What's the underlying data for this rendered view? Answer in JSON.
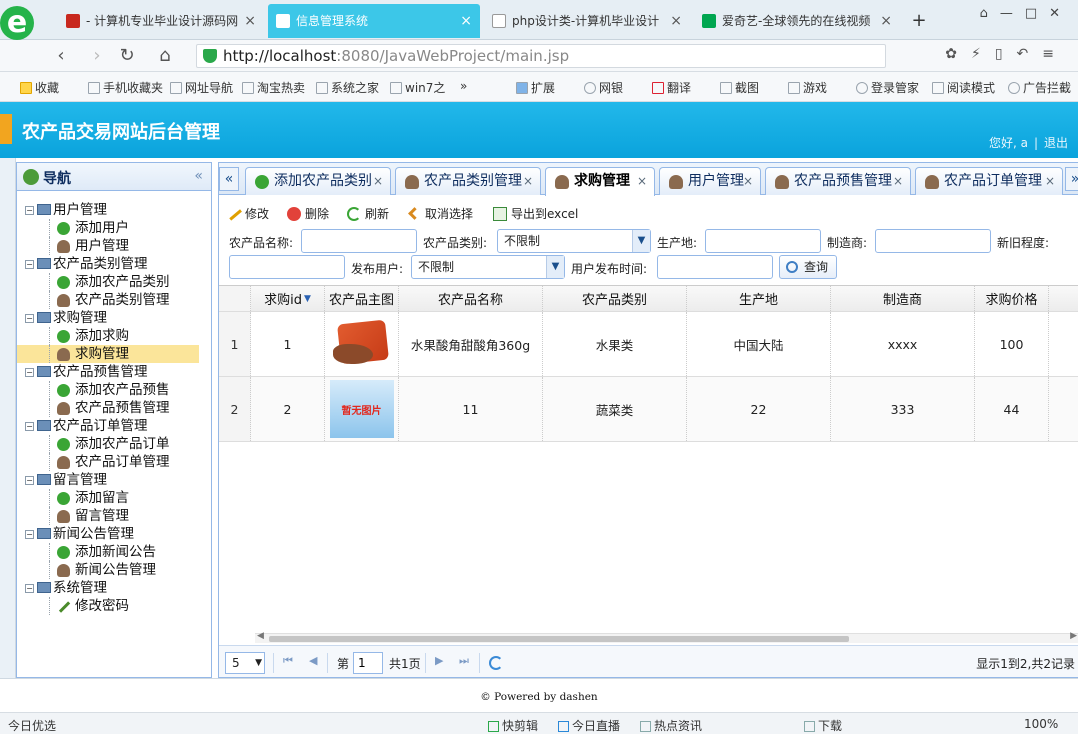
{
  "browser": {
    "tabs": [
      {
        "title": "- 计算机专业毕业设计源码网",
        "active": false,
        "color": "#c8281e"
      },
      {
        "title": "信息管理系统",
        "active": true,
        "color": "#ffffff"
      },
      {
        "title": "php设计类-计算机毕业设计",
        "active": false,
        "color": "#999999"
      },
      {
        "title": "爱奇艺-全球领先的在线视频",
        "active": false,
        "color": "#00a650"
      }
    ],
    "new_tab": "+",
    "url_host": "http://localhost",
    "url_path": ":8080/JavaWebProject/main.jsp",
    "bookmarks": [
      "收藏",
      "手机收藏夹",
      "网址导航",
      "淘宝热卖",
      "系统之家",
      "win7之",
      "»",
      "扩展",
      "网银",
      "翻译",
      "截图",
      "游戏",
      "登录管家",
      "阅读模式",
      "广告拦截"
    ]
  },
  "app": {
    "title": "农产品交易网站后台管理",
    "greeting": "您好, a",
    "logout": "退出"
  },
  "sidebar": {
    "title": "导航",
    "collapse": "«",
    "groups": [
      {
        "label": "用户管理",
        "children": [
          {
            "label": "添加用户",
            "icon": "add"
          },
          {
            "label": "用户管理",
            "icon": "user"
          }
        ]
      },
      {
        "label": "农产品类别管理",
        "children": [
          {
            "label": "添加农产品类别",
            "icon": "add"
          },
          {
            "label": "农产品类别管理",
            "icon": "user"
          }
        ]
      },
      {
        "label": "求购管理",
        "children": [
          {
            "label": "添加求购",
            "icon": "add"
          },
          {
            "label": "求购管理",
            "icon": "user",
            "selected": true
          }
        ]
      },
      {
        "label": "农产品预售管理",
        "children": [
          {
            "label": "添加农产品预售",
            "icon": "add"
          },
          {
            "label": "农产品预售管理",
            "icon": "user"
          }
        ]
      },
      {
        "label": "农产品订单管理",
        "children": [
          {
            "label": "添加农产品订单",
            "icon": "add"
          },
          {
            "label": "农产品订单管理",
            "icon": "user"
          }
        ]
      },
      {
        "label": "留言管理",
        "children": [
          {
            "label": "添加留言",
            "icon": "add"
          },
          {
            "label": "留言管理",
            "icon": "user"
          }
        ]
      },
      {
        "label": "新闻公告管理",
        "children": [
          {
            "label": "添加新闻公告",
            "icon": "add"
          },
          {
            "label": "新闻公告管理",
            "icon": "user"
          }
        ]
      },
      {
        "label": "系统管理",
        "children": [
          {
            "label": "修改密码",
            "icon": "pen"
          }
        ]
      }
    ]
  },
  "main_tabs": [
    {
      "label": "添加农产品类别",
      "icon": "add"
    },
    {
      "label": "农产品类别管理",
      "icon": "user"
    },
    {
      "label": "求购管理",
      "icon": "user",
      "active": true
    },
    {
      "label": "用户管理",
      "icon": "user"
    },
    {
      "label": "农产品预售管理",
      "icon": "user"
    },
    {
      "label": "农产品订单管理",
      "icon": "user"
    }
  ],
  "tab_scroll_left": "«",
  "tab_scroll_right": "»",
  "tab_close": "×",
  "toolbar": {
    "edit": "修改",
    "delete": "删除",
    "refresh": "刷新",
    "unselect": "取消选择",
    "export": "导出到excel"
  },
  "filters": {
    "name_label": "农产品名称:",
    "category_label": "农产品类别:",
    "category_value": "不限制",
    "origin_label": "生产地:",
    "maker_label": "制造商:",
    "newness_label": "新旧程度:",
    "poster_label": "发布用户:",
    "poster_value": "不限制",
    "time_label": "用户发布时间:",
    "search": "查询"
  },
  "grid": {
    "columns": [
      "求购id",
      "农产品主图",
      "农产品名称",
      "农产品类别",
      "生产地",
      "制造商",
      "求购价格"
    ],
    "sort_indicator": "▼",
    "rows": [
      {
        "rownum": "1",
        "id": "1",
        "image": "snack",
        "name": "水果酸角甜酸角360g",
        "category": "水果类",
        "origin": "中国大陆",
        "maker": "xxxx",
        "price": "100"
      },
      {
        "rownum": "2",
        "id": "2",
        "image": "none",
        "image_text": "暂无图片",
        "name": "11",
        "category": "蔬菜类",
        "origin": "22",
        "maker": "333",
        "price": "44"
      }
    ]
  },
  "pager": {
    "page_size": "5",
    "page_prefix": "第",
    "page_value": "1",
    "page_total": "共1页",
    "info": "显示1到2,共2记录"
  },
  "footer": "© Powered by dashen",
  "statusbar": {
    "left": "今日优选",
    "items": [
      "快剪辑",
      "今日直播",
      "热点资讯",
      "下载"
    ],
    "zoom": "100%"
  },
  "colors": {
    "header": "#0aa3dc",
    "panel_border": "#95b8e7",
    "selected": "#fbe59a"
  }
}
